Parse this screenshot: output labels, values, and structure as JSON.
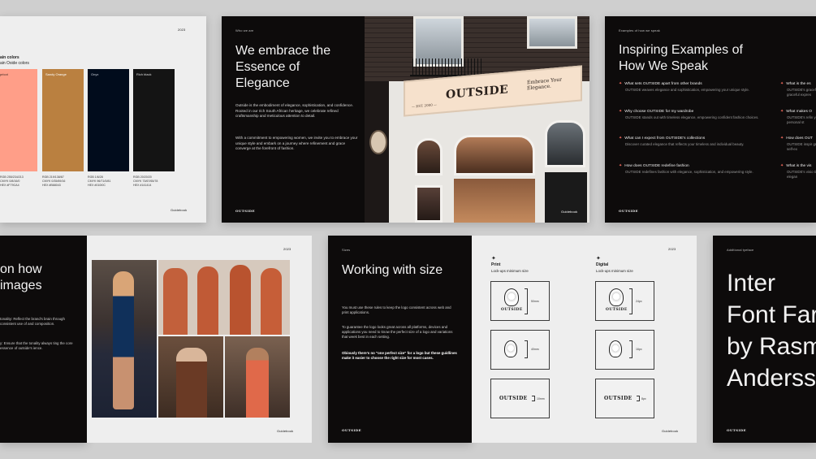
{
  "colors": {
    "apricot": "#FF9E88",
    "sandy_orange": "#BA8040",
    "onyx": "#010C1C",
    "rich_black": "#141414",
    "star": "#FF7061"
  },
  "panel1": {
    "year": "2023",
    "heading": "ain colors",
    "subheading": "ain Oxide colors",
    "swatches": [
      {
        "label": "pricot",
        "spec": "RGB  255/234/213\nCMYK  0/8/16/0\nHEX  #F79CA4"
      },
      {
        "label": "Sandy Orange",
        "spec": "RGB  219/138/67\nCMYK  0/35/69/16\nHEX  #B68043"
      },
      {
        "label": "Onyx",
        "spec": "RGB  1/6/28\nCMYK  96/71/0/81\nHEX  #010I0C"
      },
      {
        "label": "Rich black",
        "spec": "RGB  20/20/20\nCMYK  73/67/65/78\nHEX  #141414"
      }
    ],
    "footer": "Guidebook"
  },
  "panel2": {
    "eyebrow": "Who we are",
    "title": "We embrace the Essence of Elegance",
    "paragraph1": "Outside is the embodiment of elegance, sophistication, and confidence. Rooted in our rich South African heritage, we celebrate refined craftsmanship and meticulous attention to detail.",
    "paragraph2": "With a commitment to empowering women, we invite you to embrace your unique style and embark on a journey where refinement and grace converge at the forefront of fashion.",
    "logo": "OUTSIDE",
    "footer": "Guidebook",
    "storefront": {
      "brand": "OUTSIDE",
      "est": "— EST. 2000 —",
      "tagline": "Embrace Your Elegance."
    }
  },
  "panel3": {
    "eyebrow": "Examples of how we speak",
    "title": "Inspiring Examples of How We Speak",
    "items": [
      {
        "q": "What sets OUTSIDE apart from other brands",
        "a": "OUTSIDE weaves elegance and sophistication, empowering your unique style."
      },
      {
        "q": "Why choose OUTSIDE for my wardrobe",
        "a": "OUTSIDE stands out with timeless elegance, empowering confident fashion choices."
      },
      {
        "q": "What can I expect from OUTSIDE's collections",
        "a": "Discover curated elegance that reflects your timeless and individual beauty."
      },
      {
        "q": "How does OUTSIDE redefine fashion",
        "a": "OUTSIDE redefines fashion with elegance, sophistication, and empowering style."
      }
    ],
    "items2": [
      {
        "q": "What is the es",
        "a": "OUTSIDE's gracef graceful expres"
      },
      {
        "q": "What makes O",
        "a": "OUTSIDE's refin your personal st"
      },
      {
        "q": "How does OUT",
        "a": "OUTSIDE inspir graceful self-ex"
      },
      {
        "q": "What is the vis",
        "a": "OUTSIDE's visio timeless elegan"
      }
    ],
    "logo": "OUTSIDE",
    "footer": "Guidebook"
  },
  "panel4": {
    "title": "on how images",
    "para1": "tonality: Reflect the brand's brain through consistent use of and composition.",
    "para2": "y: Ensure that the tonality always ting the core essence of outside's ience.",
    "year": "2023",
    "footer": "Guidebook"
  },
  "panel5": {
    "eyebrow": "Sizes",
    "title": "Working with size",
    "para1": "You must use these rules to keep the logo consistent across web and print applications.",
    "para2": "To guarantee the logo looks great across all platforms, devices and applications you need to know the perfect size of a logo and variations that week best in each setting.",
    "para3": "Obiously there's no \"one perfect size\" for a logo but these guidlines make it easier to choose the right size for most cases.",
    "logo": "OUTSIDE"
  },
  "panel6": {
    "year": "2023",
    "print": {
      "title": "Print",
      "subtitle": "Lock-ups minimum size",
      "sizes": [
        "50mm",
        "40mm",
        "10mm"
      ]
    },
    "digital": {
      "title": "Digital",
      "subtitle": "Lock-ups minimum size",
      "sizes": [
        "24px",
        "16px",
        "8px"
      ]
    },
    "emblem_word": "OUTSIDE",
    "footer": "Guidebook"
  },
  "panel7": {
    "eyebrow": "Additional tyeface",
    "lines": [
      "Inter",
      "Font Far",
      "by Rasm",
      "Anderss"
    ],
    "logo": "OUTSIDE"
  }
}
